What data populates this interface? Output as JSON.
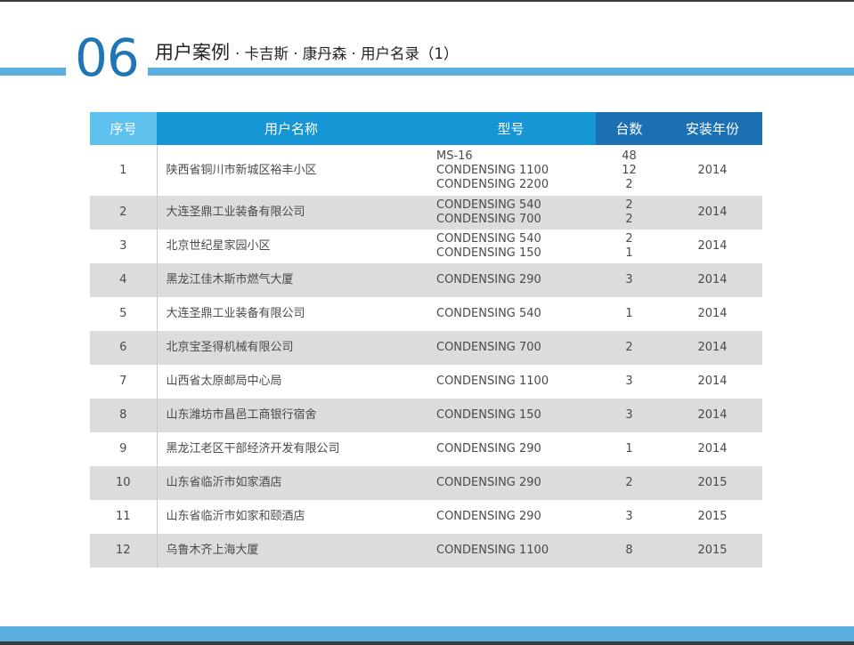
{
  "header": {
    "number": "06",
    "title": "用户案例",
    "subtitle": "· 卡吉斯 · 康丹森 · 用户名录（1）"
  },
  "colors": {
    "accent_dark": "#1f76b6",
    "accent_light": "#5aaee0",
    "header_light": "#5fc1ee",
    "header_mid": "#1796d6",
    "header_dark": "#1b70b3",
    "row_alt": "#dcdcdc"
  },
  "table": {
    "columns": [
      "序号",
      "用户名称",
      "型号",
      "台数",
      "安装年份"
    ],
    "rows": [
      {
        "seq": "1",
        "name": "陕西省铜川市新城区裕丰小区",
        "models": [
          "MS-16",
          "CONDENSING 1100",
          "CONDENSING 2200"
        ],
        "qty": [
          "48",
          "12",
          "2"
        ],
        "year": "2014"
      },
      {
        "seq": "2",
        "name": "大连圣鼎工业装备有限公司",
        "models": [
          "CONDENSING 540",
          "CONDENSING 700"
        ],
        "qty": [
          "2",
          "2"
        ],
        "year": "2014"
      },
      {
        "seq": "3",
        "name": "北京世纪星家园小区",
        "models": [
          "CONDENSING 540",
          "CONDENSING 150"
        ],
        "qty": [
          "2",
          "1"
        ],
        "year": "2014"
      },
      {
        "seq": "4",
        "name": "黑龙江佳木斯市燃气大厦",
        "models": [
          "CONDENSING 290"
        ],
        "qty": [
          "3"
        ],
        "year": "2014"
      },
      {
        "seq": "5",
        "name": "大连圣鼎工业装备有限公司",
        "models": [
          "CONDENSING 540"
        ],
        "qty": [
          "1"
        ],
        "year": "2014"
      },
      {
        "seq": "6",
        "name": "北京宝圣得机械有限公司",
        "models": [
          "CONDENSING 700"
        ],
        "qty": [
          "2"
        ],
        "year": "2014"
      },
      {
        "seq": "7",
        "name": "山西省太原邮局中心局",
        "models": [
          "CONDENSING 1100"
        ],
        "qty": [
          "3"
        ],
        "year": "2014"
      },
      {
        "seq": "8",
        "name": "山东潍坊市昌邑工商银行宿舍",
        "models": [
          "CONDENSING 150"
        ],
        "qty": [
          "3"
        ],
        "year": "2014"
      },
      {
        "seq": "9",
        "name": "黑龙江老区干部经济开发有限公司",
        "models": [
          "CONDENSING 290"
        ],
        "qty": [
          "1"
        ],
        "year": "2014"
      },
      {
        "seq": "10",
        "name": "山东省临沂市如家酒店",
        "models": [
          "CONDENSING 290"
        ],
        "qty": [
          "2"
        ],
        "year": "2015"
      },
      {
        "seq": "11",
        "name": "山东省临沂市如家和颐酒店",
        "models": [
          "CONDENSING 290"
        ],
        "qty": [
          "3"
        ],
        "year": "2015"
      },
      {
        "seq": "12",
        "name": "乌鲁木齐上海大厦",
        "models": [
          "CONDENSING 1100"
        ],
        "qty": [
          "8"
        ],
        "year": "2015"
      }
    ]
  }
}
